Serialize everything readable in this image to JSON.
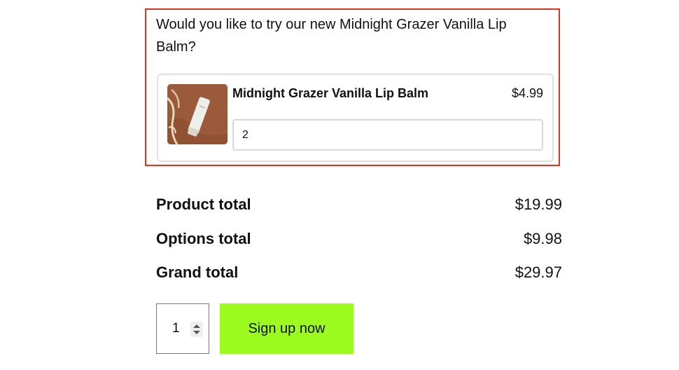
{
  "upsell": {
    "question": "Would you like to try our new Midnight Grazer Vanilla Lip Balm?",
    "product": {
      "name": "Midnight Grazer Vanilla Lip Balm",
      "price": "$4.99",
      "quantity_value": "2",
      "image_icon": "lip-balm-tube-image"
    }
  },
  "totals": {
    "product_total_label": "Product total",
    "product_total_value": "$19.99",
    "options_total_label": "Options total",
    "options_total_value": "$9.98",
    "grand_total_label": "Grand total",
    "grand_total_value": "$29.97"
  },
  "checkout": {
    "quantity": "1",
    "signup_label": "Sign up now"
  },
  "colors": {
    "highlight_border": "#e5311c",
    "signup_button": "#9cfc20"
  }
}
